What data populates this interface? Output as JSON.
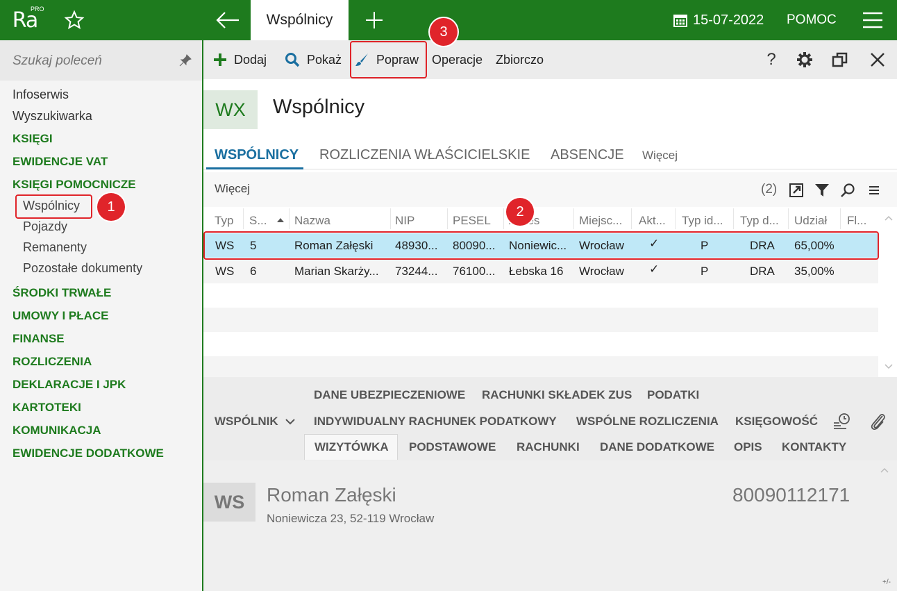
{
  "topbar": {
    "logo": "Ra",
    "logo_sup": "PRO",
    "active_tab": "Wspólnicy",
    "date": "15-07-2022",
    "help": "POMOC"
  },
  "sidebar": {
    "search_placeholder": "Szukaj poleceń",
    "items": [
      "Infoserwis",
      "Wyszukiwarka"
    ],
    "categories": [
      "KSIĘGI",
      "EWIDENCJE VAT",
      "KSIĘGI POMOCNICZE",
      "ŚRODKI TRWAŁE",
      "UMOWY I PŁACE",
      "FINANSE",
      "ROZLICZENIA",
      "DEKLARACJE I JPK",
      "KARTOTEKI",
      "KOMUNIKACJA",
      "EWIDENCJE DODATKOWE"
    ],
    "subitems": [
      "Wspólnicy",
      "Pojazdy",
      "Remanenty",
      "Pozostałe dokumenty"
    ]
  },
  "badges": [
    "1",
    "2",
    "3"
  ],
  "toolbar": {
    "add": "Dodaj",
    "show": "Pokaż",
    "edit": "Popraw",
    "operations": "Operacje",
    "summary": "Zbiorczo",
    "help_icon": "?"
  },
  "header": {
    "code": "WX",
    "title": "Wspólnicy"
  },
  "tabs": [
    "WSPÓLNICY",
    "ROZLICZENIA WŁAŚCICIELSKIE",
    "ABSENCJE",
    "Więcej"
  ],
  "grid": {
    "more": "Więcej",
    "count": "(2)",
    "columns": [
      "Typ",
      "S...",
      "Nazwa",
      "NIP",
      "PESEL",
      "Adres",
      "Miejsc...",
      "Akt...",
      "Typ id...",
      "Typ d...",
      "Udział",
      "Fl..."
    ],
    "rows": [
      [
        "WS",
        "5",
        "Roman Załęski",
        "48930...",
        "80090...",
        "Noniewic...",
        "Wrocław",
        "✓",
        "P",
        "DRA",
        "65,00%"
      ],
      [
        "WS",
        "6",
        "Marian Skarży...",
        "73244...",
        "76100...",
        "Łebska 16",
        "Wrocław",
        "✓",
        "P",
        "DRA",
        "35,00%"
      ]
    ]
  },
  "detail": {
    "tabs_row1": [
      "DANE UBEZPIECZENIOWE",
      "RACHUNKI SKŁADEK ZUS",
      "PODATKI"
    ],
    "section": "WSPÓLNIK",
    "tabs_row2": [
      "INDYWIDUALNY RACHUNEK PODATKOWY",
      "WSPÓLNE ROZLICZENIA",
      "KSIĘGOWOŚĆ"
    ],
    "tabs_row3": [
      "WIZYTÓWKA",
      "PODSTAWOWE",
      "RACHUNKI",
      "DANE DODATKOWE",
      "OPIS",
      "KONTAKTY"
    ],
    "card": {
      "code": "WS",
      "name": "Roman Załęski",
      "address": "Noniewicza 23, 52-119 Wrocław",
      "number": "80090112171"
    }
  },
  "corner": "+/-"
}
